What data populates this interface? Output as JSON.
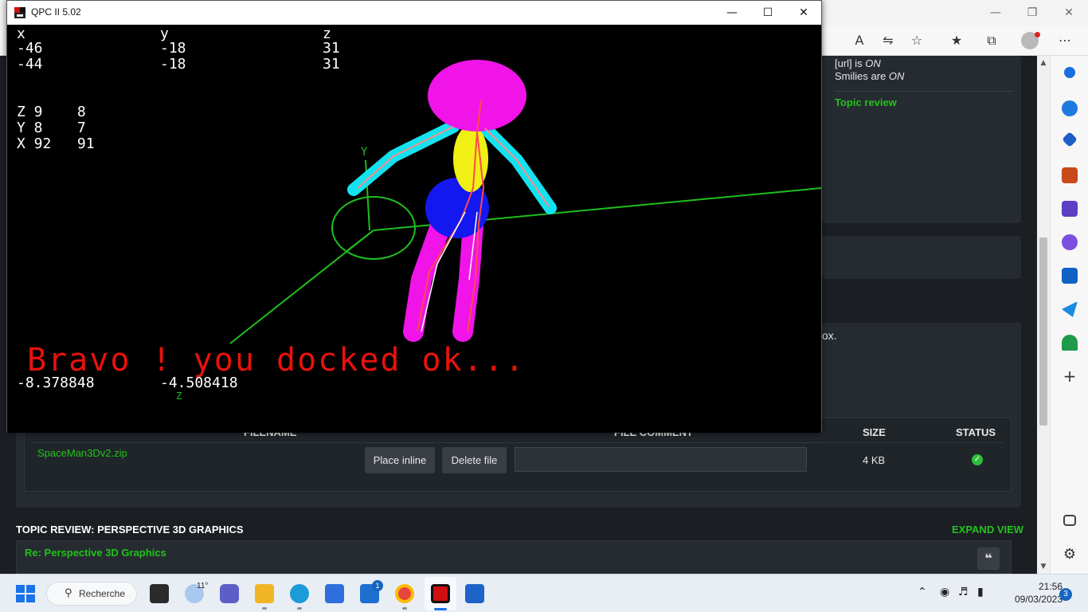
{
  "qpc": {
    "title": "QPC II 5.02",
    "readouts": {
      "header_x": "x",
      "header_y": "y",
      "header_z": "z",
      "row1": [
        "-46",
        "-18",
        "31"
      ],
      "row2": [
        "-44",
        "-18",
        "31"
      ],
      "angles": [
        "Z 9    8",
        "Y 8    7",
        "X 92   91"
      ]
    },
    "message": "Bravo ! you docked ok...",
    "coords": [
      "-8.378848",
      "-4.508418"
    ],
    "axis_label_y": "Y",
    "axis_label_z": "Z"
  },
  "forum": {
    "url_status_prefix": "[url] is ",
    "url_status_value": "ON",
    "smilies_prefix": "Smilies are ",
    "smilies_value": "ON",
    "topic_review_link": "Topic review",
    "box_text_fragment": "ox.",
    "table": {
      "col_filename": "FILENAME",
      "col_comment": "FILE COMMENT",
      "col_size": "SIZE",
      "col_status": "STATUS",
      "file_name": "SpaceMan3Dv2.zip",
      "place_inline": "Place inline",
      "delete_file": "Delete file",
      "file_size": "4 KB"
    },
    "topic_review_heading": "TOPIC REVIEW: PERSPECTIVE 3D GRAPHICS",
    "expand_view": "EXPAND VIEW",
    "post_title": "Re: Perspective 3D Graphics"
  },
  "taskbar": {
    "search_label": "Recherche",
    "weather_temp": "11°",
    "mail_badge": "1",
    "time": "21:56",
    "date": "09/03/2023",
    "notification_count": "3"
  }
}
